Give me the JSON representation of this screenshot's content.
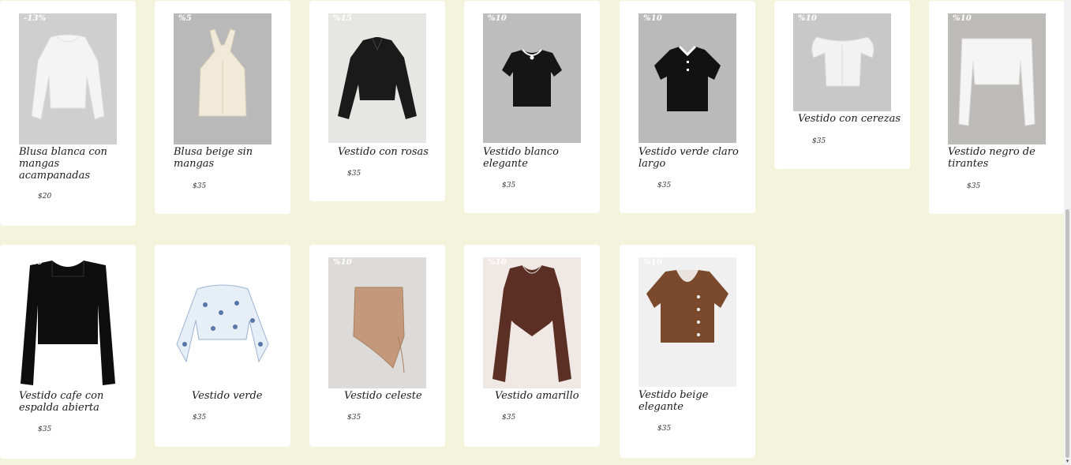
{
  "products": [
    {
      "badge": "-13%",
      "title": "Blusa blanca con mangas acampanadas",
      "price": "$20"
    },
    {
      "badge": "%5",
      "title": "Blusa beige sin mangas",
      "price": "$35"
    },
    {
      "badge": "%15",
      "title": "Vestido con rosas",
      "price": "$35"
    },
    {
      "badge": "%10",
      "title": "Vestido blanco elegante",
      "price": "$35"
    },
    {
      "badge": "%10",
      "title": "Vestido verde claro largo",
      "price": "$35"
    },
    {
      "badge": "%10",
      "title": "Vestido con cerezas",
      "price": "$35"
    },
    {
      "badge": "%10",
      "title": "Vestido negro de tirantes",
      "price": "$35"
    },
    {
      "badge": "%10",
      "title": "Vestido cafe con espalda abierta",
      "price": "$35"
    },
    {
      "badge": "",
      "title": "Vestido verde",
      "price": "$35"
    },
    {
      "badge": "%10",
      "title": "Vestido celeste",
      "price": "$35"
    },
    {
      "badge": "%10",
      "title": "Vestido amarillo",
      "price": "$35"
    },
    {
      "badge": "%10",
      "title": "Vestido beige elegante",
      "price": "$35"
    }
  ],
  "scrollbar": {
    "down_arrow": "▾"
  }
}
